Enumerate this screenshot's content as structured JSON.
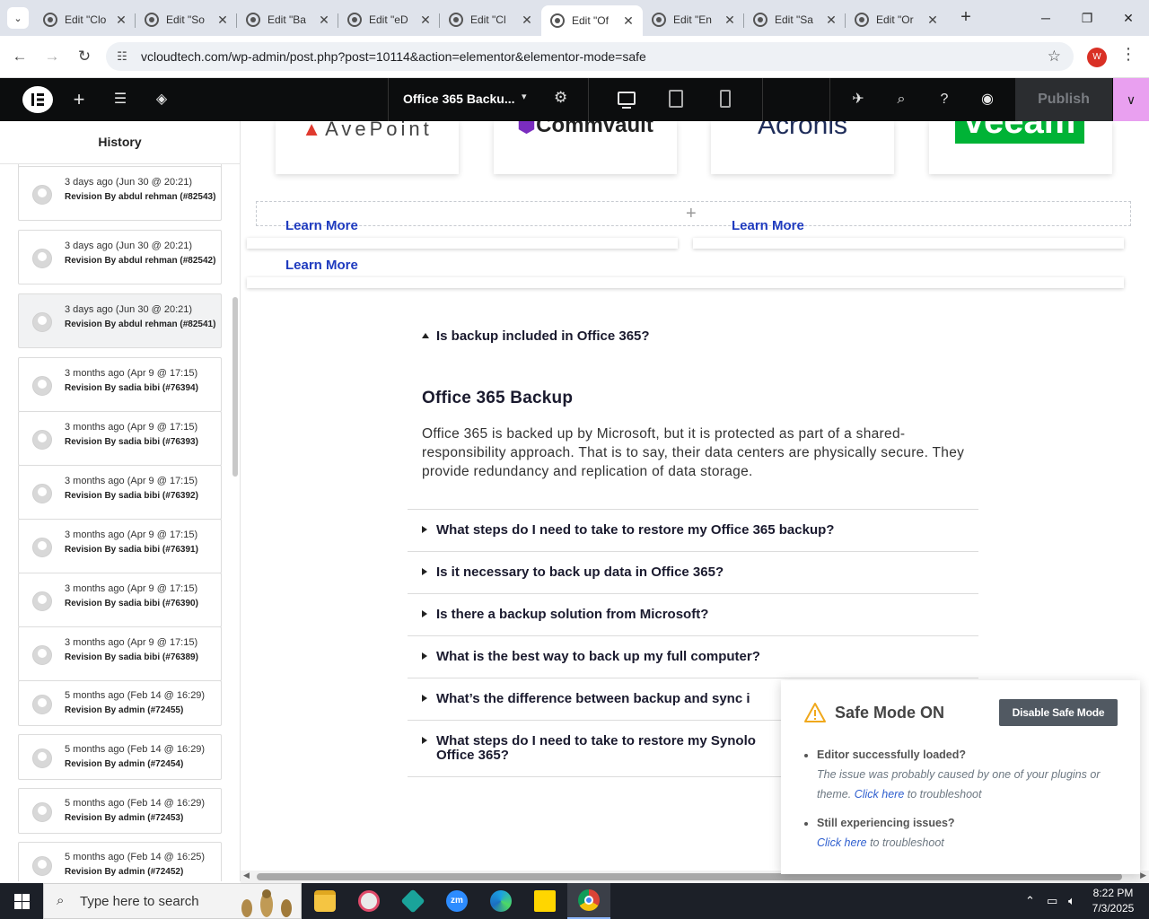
{
  "browser": {
    "tabs": [
      {
        "title": "Edit \"Clo",
        "active": false
      },
      {
        "title": "Edit \"So",
        "active": false
      },
      {
        "title": "Edit \"Ba",
        "active": false
      },
      {
        "title": "Edit \"eD",
        "active": false
      },
      {
        "title": "Edit \"Cl",
        "active": false
      },
      {
        "title": "Edit \"Of",
        "active": true
      },
      {
        "title": "Edit \"En",
        "active": false
      },
      {
        "title": "Edit \"Sa",
        "active": false
      },
      {
        "title": "Edit \"Or",
        "active": false
      }
    ],
    "url": "vcloudtech.com/wp-admin/post.php?post=10114&action=elementor&elementor-mode=safe",
    "profile_initial": "W"
  },
  "elementor": {
    "document_title": "Office 365 Backu...",
    "publish_label": "Publish"
  },
  "history": {
    "title": "History",
    "revisions": [
      {
        "when": "3 days ago (Jun 30 @ 20:21)",
        "by": "Revision By abdul rehman (#82543)",
        "selected": false
      },
      {
        "when": "3 days ago (Jun 30 @ 20:21)",
        "by": "Revision By abdul rehman (#82542)",
        "selected": false
      },
      {
        "when": "3 days ago (Jun 30 @ 20:21)",
        "by": "Revision By abdul rehman (#82541)",
        "selected": true
      },
      {
        "when": "3 months ago (Apr 9 @ 17:15)",
        "by": "Revision By sadia bibi (#76394)",
        "selected": false
      },
      {
        "when": "3 months ago (Apr 9 @ 17:15)",
        "by": "Revision By sadia bibi (#76393)",
        "selected": false
      },
      {
        "when": "3 months ago (Apr 9 @ 17:15)",
        "by": "Revision By sadia bibi (#76392)",
        "selected": false
      },
      {
        "when": "3 months ago (Apr 9 @ 17:15)",
        "by": "Revision By sadia bibi (#76391)",
        "selected": false
      },
      {
        "when": "3 months ago (Apr 9 @ 17:15)",
        "by": "Revision By sadia bibi (#76390)",
        "selected": false
      },
      {
        "when": "3 months ago (Apr 9 @ 17:15)",
        "by": "Revision By sadia bibi (#76389)",
        "selected": false
      },
      {
        "when": "5 months ago (Feb 14 @ 16:29)",
        "by": "Revision By admin (#72455)",
        "selected": false
      },
      {
        "when": "5 months ago (Feb 14 @ 16:29)",
        "by": "Revision By admin (#72454)",
        "selected": false
      },
      {
        "when": "5 months ago (Feb 14 @ 16:29)",
        "by": "Revision By admin (#72453)",
        "selected": false
      },
      {
        "when": "5 months ago (Feb 14 @ 16:25)",
        "by": "Revision By admin (#72452)",
        "selected": false
      }
    ]
  },
  "canvas": {
    "logos": [
      "AvePoint",
      "Commvault",
      "Acronis",
      "veeam"
    ],
    "learn_more": "Learn More",
    "faq_open_question": "Is backup included in Office 365?",
    "answer_title": "Office 365 Backup",
    "answer_body": "Office 365 is backed up by Microsoft, but it is protected as part of a shared-responsibility approach. That is to say, their data centers are physically secure. They provide redundancy and replication of data storage.",
    "faq_questions": [
      "What steps do I need to take to restore my Office 365 backup?",
      "Is it necessary to back up data in Office 365?",
      "Is there a backup solution from Microsoft?",
      "What is the best way to back up my full computer?",
      "What’s the difference between backup and sync i",
      "What steps do I need to take to restore my Synolo",
      "Office 365?"
    ]
  },
  "safe_mode": {
    "heading": "Safe Mode ON",
    "disable_label": "Disable Safe Mode",
    "item1_title": "Editor successfully loaded?",
    "item1_desc": "The issue was probably caused by one of your plugins or theme.",
    "item1_link": "Click here",
    "item1_tail": "to troubleshoot",
    "item2_title": "Still experiencing issues?",
    "item2_link": "Click here",
    "item2_tail": "to troubleshoot"
  },
  "taskbar": {
    "search_placeholder": "Type here to search",
    "time": "8:22 PM",
    "date": "7/3/2025"
  },
  "colors": {
    "learn_more": "#1f3bbf",
    "publish_more": "#e9a0f0",
    "avepoint_red": "#e03a2f",
    "commvault_purple": "#7a2dbf",
    "acronis_navy": "#1f2d5a",
    "veeam_green": "#00b336"
  }
}
